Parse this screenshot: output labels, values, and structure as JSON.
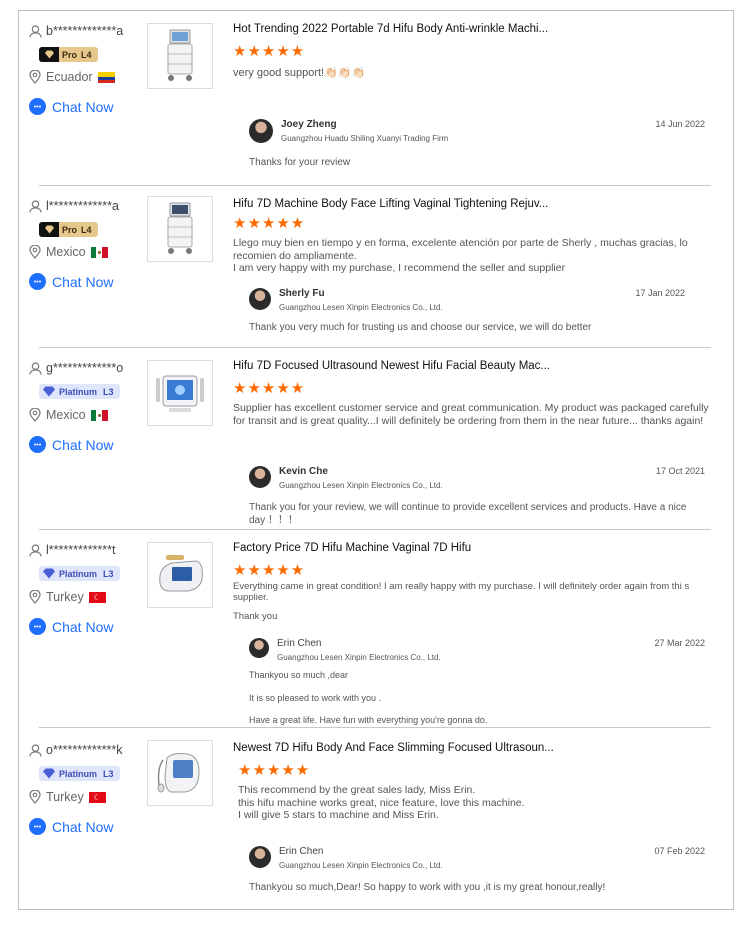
{
  "chat_label": "Chat Now",
  "colors": {
    "accent": "#1f6fff",
    "stars": "#ff6a00"
  },
  "reviews": [
    {
      "buyer": "b*************a",
      "badge": {
        "type": "pro",
        "name": "Pro",
        "level": "L4"
      },
      "country": "Ecuador",
      "flag": "ecuador-flag",
      "product_image": "hifu-trolley-machine",
      "product_title": "Hot Trending 2022 Portable 7d Hifu Body Anti-wrinkle Machi...",
      "stars": "★★★★★",
      "rating": 5,
      "text": [
        "very good support!👏🏻👏🏻👏🏻"
      ],
      "reply": {
        "name": "Joey Zheng",
        "company": "Guangzhou Huadu Shiling Xuanyi Trading Firm",
        "date": "14 Jun 2022",
        "text": [
          "Thanks for your review"
        ]
      }
    },
    {
      "buyer": "l*************a",
      "badge": {
        "type": "pro",
        "name": "Pro",
        "level": "L4"
      },
      "country": "Mexico",
      "flag": "mexico-flag",
      "product_image": "hifu-trolley-machine",
      "product_title": "Hifu 7D Machine Body Face Lifting Vaginal Tightening Rejuv...",
      "stars": "★★★★★",
      "rating": 5,
      "text": [
        "Llego muy bien en tiempo y en forma, excelente atención por parte de Sherly , muchas gracias, lo recomien do ampliamente.",
        "I am very happy with my purchase, I recommend the seller and supplier"
      ],
      "reply": {
        "name": "Sherly Fu",
        "company": "Guangzhou Lesen Xinpin Electronics Co., Ltd.",
        "date": "17 Jan 2022",
        "text": [
          "Thank you very much for trusting us and choose our service, we will do better"
        ]
      }
    },
    {
      "buyer": "g*************o",
      "badge": {
        "type": "plat",
        "name": "Platinum",
        "level": "L3"
      },
      "country": "Mexico",
      "flag": "mexico-flag",
      "product_image": "hifu-portable-screen",
      "product_title": "Hifu 7D Focused Ultrasound Newest Hifu Facial Beauty Mac...",
      "stars": "★★★★★",
      "rating": 5,
      "text": [
        "Supplier has excellent customer service and great communication. My product was packaged carefully for transit and is great quality...I will definitely be ordering from them in the near future... thanks again!"
      ],
      "reply": {
        "name": "Kevin Che",
        "company": "Guangzhou Lesen Xinpin Electronics Co., Ltd.",
        "date": "17 Oct 2021",
        "text": [
          "Thank you for your review, we will continue to provide excellent services and products. Have a nice day ！！！"
        ]
      }
    },
    {
      "buyer": "l*************t",
      "badge": {
        "type": "plat",
        "name": "Platinum",
        "level": "L3"
      },
      "country": "Turkey",
      "flag": "turkey-flag",
      "product_image": "hifu-portable-white",
      "product_title": "Factory Price 7D Hifu Machine Vaginal 7D Hifu",
      "stars": "★★★★★",
      "rating": 5,
      "text": [
        "Everything came in great condition! I am really happy with my purchase. I will definitely order again from thi s supplier.",
        "Thank you"
      ],
      "reply": {
        "name": "Erin Chen",
        "company": "Guangzhou Lesen Xinpin Electronics Co., Ltd.",
        "date": "27 Mar 2022",
        "text": [
          "Thankyou so much ,dear",
          "It is so pleased to work with you .",
          "Have a great life. Have fun with everything you're gonna do."
        ]
      }
    },
    {
      "buyer": "o*************k",
      "badge": {
        "type": "plat",
        "name": "Platinum",
        "level": "L3"
      },
      "country": "Turkey",
      "flag": "turkey-flag",
      "product_image": "hifu-portable-white",
      "product_title": "Newest 7D Hifu Body And Face Slimming Focused Ultrasoun...",
      "stars": "★★★★★",
      "rating": 5,
      "text": [
        "This recommend by the great sales lady, Miss Erin.",
        "this hifu machine works great, nice feature, love this machine.",
        "I will give 5 stars to machine and Miss Erin."
      ],
      "reply": {
        "name": "Erin Chen",
        "company": "Guangzhou Lesen Xinpin Electronics Co., Ltd.",
        "date": "07 Feb 2022",
        "text": [
          "Thankyou so much,Dear! So happy to work with you ,it is my great honour,really!"
        ]
      }
    }
  ]
}
